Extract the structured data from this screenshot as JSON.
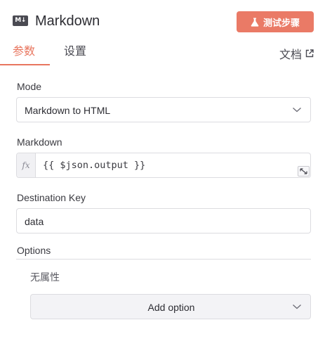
{
  "header": {
    "logo_text": "M↓",
    "title": "Markdown",
    "test_button_label": "测试步骤",
    "test_button_icon": "flask-icon",
    "accent_color": "#ea7a66"
  },
  "tabs": [
    {
      "label": "参数",
      "active": true
    },
    {
      "label": "设置",
      "active": false
    }
  ],
  "docs": {
    "label": "文档",
    "icon": "external-link-icon"
  },
  "fields": {
    "mode": {
      "label": "Mode",
      "value": "Markdown to HTML"
    },
    "markdown": {
      "label": "Markdown",
      "prefix": "fx",
      "value": "{{ $json.output }}"
    },
    "destination_key": {
      "label": "Destination Key",
      "value": "data"
    }
  },
  "options": {
    "title": "Options",
    "empty_text": "无属性",
    "add_label": "Add option"
  }
}
